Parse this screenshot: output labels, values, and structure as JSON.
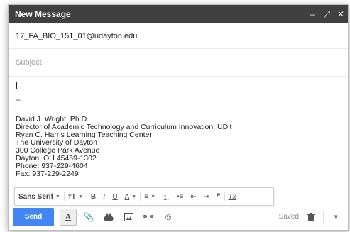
{
  "titlebar": {
    "title": "New Message",
    "minimize_icon": "minimize-icon",
    "expand_icon": "expand-icon",
    "close_icon": "close-icon"
  },
  "to": {
    "value": "17_FA_BIO_151_01@udayton.edu"
  },
  "subject": {
    "placeholder": "Subject"
  },
  "body": {
    "separator": "--",
    "signature": [
      "David J. Wright, Ph.D.",
      "Director of Academic Technology and Curriculum Innovation, UDit",
      "Ryan C. Harris Learning Teaching Center",
      "The University of Dayton",
      "300 College Park Avenue",
      "Dayton, OH 45469-1302",
      "Phone: 937-229-4604",
      "Fax: 937-229-2249"
    ]
  },
  "format_toolbar": {
    "font": "Sans Serif",
    "size_glyph": "тT",
    "bold": "B",
    "italic": "I",
    "underline": "U",
    "text_color": "A",
    "align_glyph": "≡",
    "numbered_glyph": "⒈",
    "bulleted_glyph": "•≡",
    "indent_less_glyph": "⇤",
    "indent_more_glyph": "⇥",
    "quote_glyph": "❞",
    "clear_glyph": "Tx"
  },
  "bottom": {
    "send_label": "Send",
    "format_glyph": "A",
    "saved_label": "Saved"
  },
  "colors": {
    "titlebar": "#404040",
    "send": "#4285f4"
  }
}
